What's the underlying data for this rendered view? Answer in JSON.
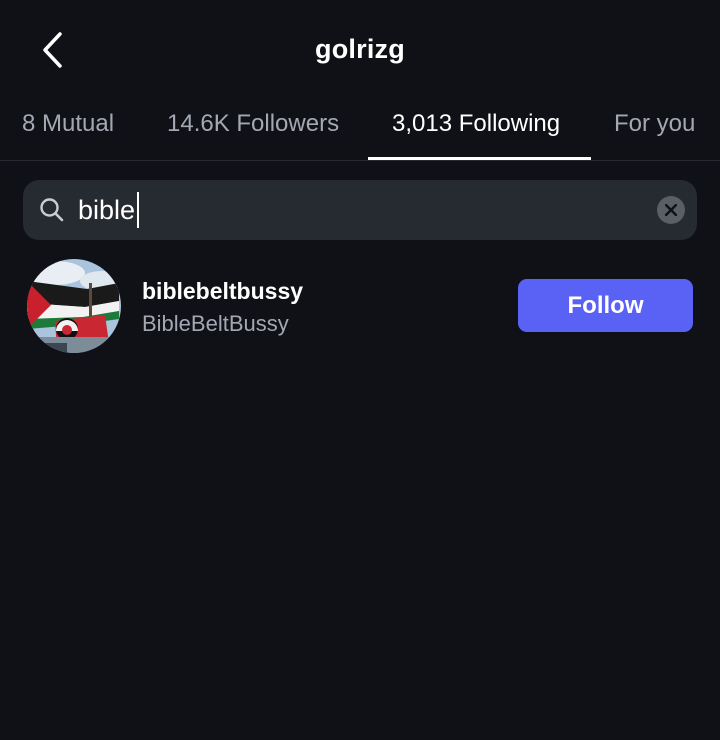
{
  "header": {
    "title": "golrizg",
    "back_icon": "chevron-left-icon"
  },
  "tabs": [
    {
      "label": "8 Mutual",
      "active": false
    },
    {
      "label": "14.6K Followers",
      "active": false
    },
    {
      "label": "3,013 Following",
      "active": true
    },
    {
      "label": "For you",
      "active": false
    }
  ],
  "search": {
    "value": "bible",
    "search_icon": "search-icon",
    "clear_icon": "clear-icon"
  },
  "results": [
    {
      "username": "biblebeltbussy",
      "display_name": "BibleBeltBussy",
      "button_label": "Follow"
    }
  ],
  "colors": {
    "background": "#0f1116",
    "search_bg": "#262a31",
    "follow_button": "#5a62f5",
    "secondary_text": "#a4a8b3"
  }
}
